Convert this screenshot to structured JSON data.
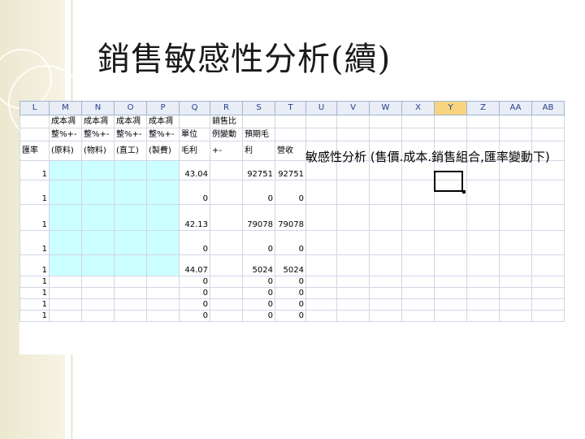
{
  "slide": {
    "title": "銷售敏感性分析(續)"
  },
  "sheet": {
    "columns": [
      "L",
      "M",
      "N",
      "O",
      "P",
      "Q",
      "R",
      "S",
      "T",
      "U",
      "V",
      "W",
      "X",
      "Y",
      "Z",
      "AA",
      "AB"
    ],
    "selected_column": "Y",
    "header_rows": [
      [
        "",
        "成本凋",
        "成本凋",
        "成本凋",
        "成本凋",
        "",
        "銷售比",
        "",
        "",
        "",
        "",
        "",
        "",
        "",
        "",
        "",
        ""
      ],
      [
        "",
        "整%+-",
        "整%+-",
        "整%+-",
        "整%+-",
        "單位",
        "例變動",
        "預期毛",
        "",
        "",
        "",
        "",
        "",
        "",
        "",
        "",
        ""
      ],
      [
        "匯率",
        "(原料)",
        "(物料)",
        "(直工)",
        "(製費)",
        "毛利",
        "+-",
        "利",
        "營收",
        "",
        "",
        "",
        "",
        "",
        "",
        "",
        ""
      ]
    ],
    "rows": [
      [
        "1",
        "",
        "",
        "",
        "",
        "43.04",
        "",
        "92751",
        "92751"
      ],
      [
        "1",
        "",
        "",
        "",
        "",
        "0",
        "",
        "0",
        "0"
      ],
      [
        "1",
        "",
        "",
        "",
        "",
        "42.13",
        "",
        "79078",
        "79078"
      ],
      [
        "1",
        "",
        "",
        "",
        "",
        "0",
        "",
        "0",
        "0"
      ],
      [
        "1",
        "",
        "",
        "",
        "",
        "44.07",
        "",
        "5024",
        "5024"
      ],
      [
        "1",
        "",
        "",
        "",
        "",
        "0",
        "",
        "0",
        "0"
      ],
      [
        "1",
        "",
        "",
        "",
        "",
        "0",
        "",
        "0",
        "0"
      ],
      [
        "1",
        "",
        "",
        "",
        "",
        "0",
        "",
        "0",
        "0"
      ],
      [
        "1",
        "",
        "",
        "",
        "",
        "0",
        "",
        "0",
        "0"
      ]
    ],
    "overlay_text": "敏感性分析 (售價.成本.銷售組合,匯率變動下)"
  },
  "colors": {
    "cyan_fill": "#ccffff",
    "selected_header": "#f8d380",
    "gridline": "#d0d7e5"
  }
}
